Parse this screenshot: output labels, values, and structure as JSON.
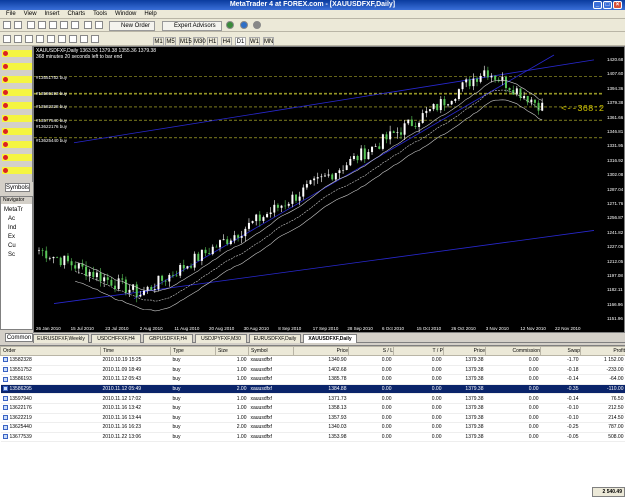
{
  "window": {
    "title": "MetaTrader 4 at FOREX.com - [XAUUSDFXF,Daily]"
  },
  "menu": [
    "File",
    "View",
    "Insert",
    "Charts",
    "Tools",
    "Window",
    "Help"
  ],
  "toolbar": {
    "new_order": "New Order",
    "expert_advisors": "Expert Advisors"
  },
  "timeframes": [
    "M1",
    "M5",
    "M15",
    "M30",
    "H1",
    "H4",
    "D1",
    "W1",
    "MN"
  ],
  "chart": {
    "header_line1": "XAUUSDFXF,Daily 1363.53 1379.38 1355.36 1379.38",
    "header_line2": "368 minutes 20 seconds left to bar end",
    "current_price_label": "<--368:2",
    "order_lines": [
      "#13551752 buy",
      "#13586193 buy",
      "#13582328 buy",
      "#13577540 buy",
      "#13622176 buy",
      "#13625440 buy"
    ],
    "y_ticks": [
      "1420.68",
      "1407.60",
      "1394.36",
      "1379.38",
      "1361.66",
      "1346.81",
      "1331.95",
      "1316.92",
      "1302.08",
      "1287.04",
      "1271.76",
      "1256.87",
      "1241.82",
      "1227.06",
      "1212.05",
      "1197.08",
      "1182.11",
      "1166.96",
      "1151.96"
    ],
    "x_ticks": [
      "26 Jan 2010",
      "15 Jul 2010",
      "23 Jul 2010",
      "2 Aug 2010",
      "11 Aug 2010",
      "20 Aug 2010",
      "30 Aug 2010",
      "8 Sep 2010",
      "17 Sep 2010",
      "28 Sep 2010",
      "6 Oct 2010",
      "15 Oct 2010",
      "26 Oct 2010",
      "3 Nov 2010",
      "12 Nov 2010",
      "22 Nov 2010"
    ],
    "colors": {
      "background": "#000000",
      "bull": "#ffffff",
      "bear": "#5ac85a",
      "ma": "#c8c8c8",
      "channel": "#2828d0",
      "order_line": "#c8c832"
    }
  },
  "market_watch": {
    "rows": 10
  },
  "symbols_tab": "Symbols",
  "navigator": {
    "header": "Navigator",
    "items": [
      "MetaTr",
      "Ac",
      "Ind",
      "Ex",
      "Cu",
      "Sc"
    ]
  },
  "common_tab": "Common",
  "chart_tabs": [
    "EURUSDFXF,Weekly",
    "USDCHFFXF,H4",
    "GBPUSDFXF,H4",
    "USDJPYFXF,M30",
    "EURUSDFXF,Daily",
    "XAUUSDFXF,Daily"
  ],
  "orders": {
    "columns": [
      "Order",
      "Time",
      "Type",
      "Size",
      "Symbol",
      "Price",
      "S / L",
      "T / P",
      "Price",
      "Commission",
      "Swap",
      "Profit"
    ],
    "rows": [
      [
        "13582328",
        "2010.10.19 15:25",
        "buy",
        "1.00",
        "xauusdfxf",
        "1340.90",
        "0.00",
        "0.00",
        "1379.38",
        "0.00",
        "-1.70",
        "1 152.00"
      ],
      [
        "13551752",
        "2010.11.09 18:49",
        "buy",
        "1.00",
        "xauusdfxf",
        "1402.68",
        "0.00",
        "0.00",
        "1379.38",
        "0.00",
        "-0.18",
        "-233.00"
      ],
      [
        "13586193",
        "2010.11.12 05:43",
        "buy",
        "1.00",
        "xauusdfxf",
        "1385.78",
        "0.00",
        "0.00",
        "1379.38",
        "0.00",
        "-0.14",
        "-64.00"
      ],
      [
        "13586295",
        "2010.11.12 05:49",
        "buy",
        "2.00",
        "xauusdfxf",
        "1384.88",
        "0.00",
        "0.00",
        "1379.38",
        "0.00",
        "-0.35",
        "-110.00"
      ],
      [
        "13597940",
        "2010.11.12 17:02",
        "buy",
        "1.00",
        "xauusdfxf",
        "1371.73",
        "0.00",
        "0.00",
        "1379.38",
        "0.00",
        "-0.14",
        "76.50"
      ],
      [
        "13622176",
        "2010.11.16 13:42",
        "buy",
        "1.00",
        "xauusdfxf",
        "1358.13",
        "0.00",
        "0.00",
        "1379.38",
        "0.00",
        "-0.10",
        "212.50"
      ],
      [
        "13622219",
        "2010.11.16 13:44",
        "buy",
        "1.00",
        "xauusdfxf",
        "1357.93",
        "0.00",
        "0.00",
        "1379.38",
        "0.00",
        "-0.10",
        "214.50"
      ],
      [
        "13625440",
        "2010.11.16 16:23",
        "buy",
        "2.00",
        "xauusdfxf",
        "1340.03",
        "0.00",
        "0.00",
        "1379.38",
        "0.00",
        "-0.25",
        "787.00"
      ],
      [
        "13677539",
        "2010.11.22 13:06",
        "buy",
        "1.00",
        "xauusdfxf",
        "1353.98",
        "0.00",
        "0.00",
        "1379.38",
        "0.00",
        "-0.05",
        "508.00"
      ]
    ],
    "selected_index": 3,
    "total": "2 540.49"
  }
}
